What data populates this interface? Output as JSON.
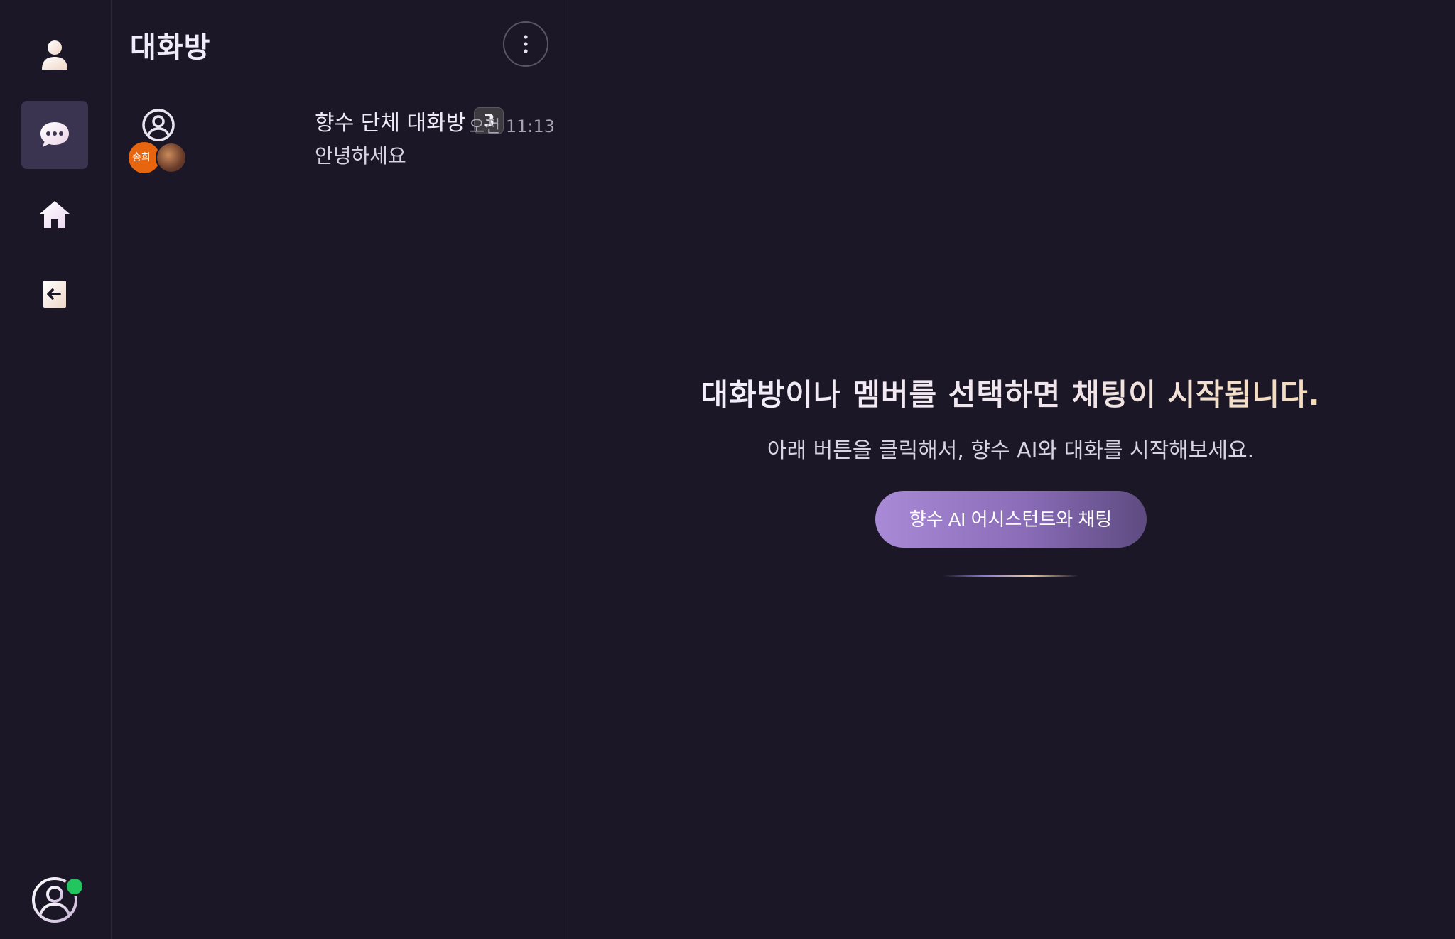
{
  "sidebar": {
    "items": [
      {
        "name": "profile",
        "icon": "user-icon"
      },
      {
        "name": "chat",
        "icon": "chat-bubble-icon",
        "active": true
      },
      {
        "name": "home",
        "icon": "home-icon"
      },
      {
        "name": "logout",
        "icon": "logout-icon"
      }
    ],
    "account": {
      "icon": "account-circle-icon",
      "status": "online",
      "status_color": "#22c55e"
    }
  },
  "room_list": {
    "title": "대화방",
    "more_icon": "more-vertical-icon",
    "rooms": [
      {
        "name": "향수 단체 대화방",
        "unread": "3",
        "time": "오전 11:13",
        "preview": "안녕하세요",
        "member_avatar_a": "송희",
        "avatar_icon": "group-avatar-icon"
      }
    ]
  },
  "main": {
    "empty_title": "대화방이나 멤버를 선택하면 채팅이 시작됩니다.",
    "empty_subtitle": "아래 버튼을 클릭해서, 향수 AI와 대화를 시작해보세요.",
    "ai_button_label": "향수 AI 어시스턴트와 채팅"
  },
  "colors": {
    "background": "#1b1726",
    "active_rail": "#3a3450",
    "accent_purple": "#a98ad6",
    "avatar_orange": "#e8650f"
  }
}
